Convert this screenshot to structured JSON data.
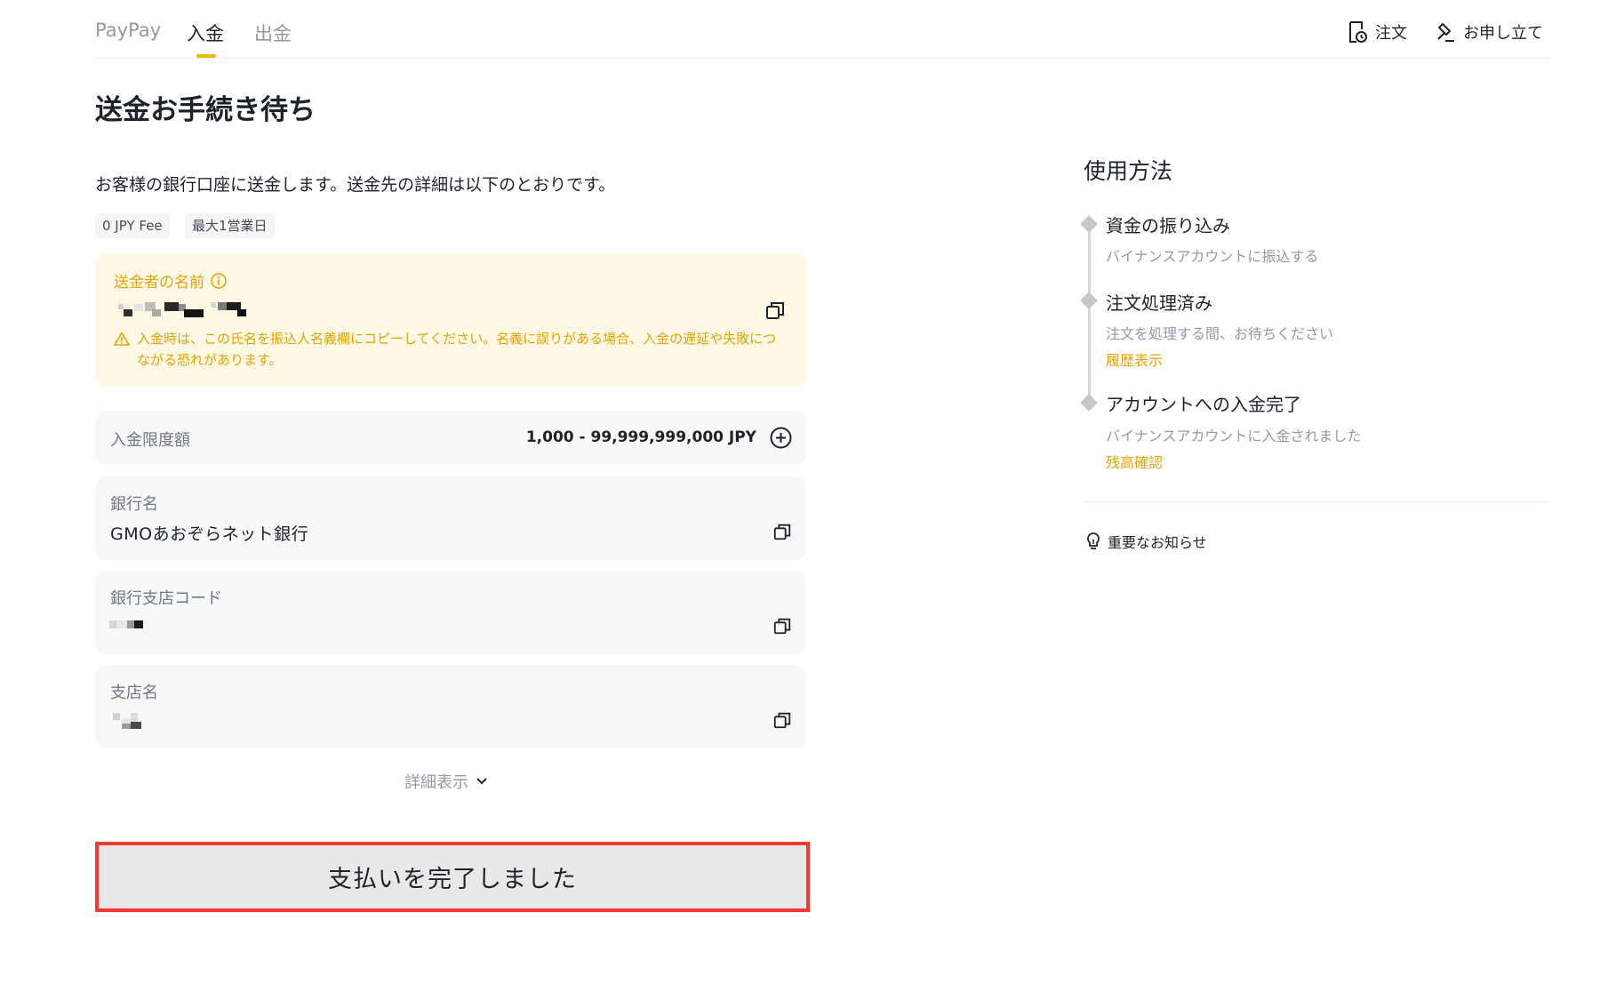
{
  "nav": {
    "tabs": [
      {
        "label": "PayPay"
      },
      {
        "label": "入金"
      },
      {
        "label": "出金"
      }
    ],
    "actions": {
      "order_label": "注文",
      "appeal_label": "お申し立て"
    }
  },
  "main": {
    "title": "送金お手続き待ち",
    "intro": "お客様の銀行口座に送金します。送金先の詳細は以下のとおりです。",
    "tags": [
      "0 JPY Fee",
      "最大1営業日"
    ],
    "sender": {
      "label": "送金者の名前",
      "warning": "入金時は、この氏名を振込人名義欄にコピーしてください。名義に誤りがある場合、入金の遅延や失敗につながる恐れがあります。"
    },
    "limit": {
      "label": "入金限度額",
      "value": "1,000 - 99,999,999,000 JPY"
    },
    "bank_name": {
      "label": "銀行名",
      "value": "GMOあおぞらネット銀行"
    },
    "branch_code": {
      "label": "銀行支店コード"
    },
    "branch_name": {
      "label": "支店名"
    },
    "details_toggle": "詳細表示",
    "confirm_button": "支払いを完了しました"
  },
  "howto": {
    "title": "使用方法",
    "steps": [
      {
        "title": "資金の振り込み",
        "desc": "バイナンスアカウントに振込する"
      },
      {
        "title": "注文処理済み",
        "desc": "注文を処理する間、お待ちください",
        "link": "履歴表示"
      },
      {
        "title": "アカウントへの入金完了",
        "desc": "バイナンスアカウントに入金されました",
        "link": "残高確認"
      }
    ],
    "notice": "重要なお知らせ"
  },
  "colors": {
    "accent": "#f0b90b",
    "warning_text": "#e5a400",
    "warning_bg": "#fef8e5",
    "highlight_border": "#f03b2e"
  }
}
